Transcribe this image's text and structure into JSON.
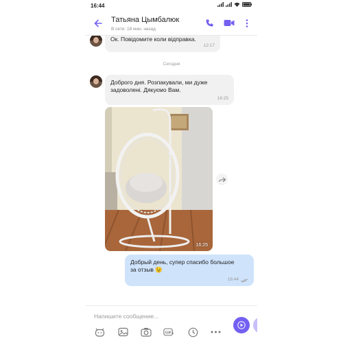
{
  "status_bar": {
    "time": "16:44"
  },
  "header": {
    "contact_name": "Татьяна Цымбалюк",
    "contact_status": "В сети: 18 мин. назад"
  },
  "messages": [
    {
      "direction": "in",
      "text": "Ок. Повідомите коли відправка.",
      "time": "12:17"
    },
    {
      "direction": "in",
      "text": "Доброго дня. Розпакували, ми дуже задоволені. Дякуємо Вам.",
      "time": "16:25"
    },
    {
      "direction": "in",
      "type": "photo",
      "time": "16:25"
    },
    {
      "direction": "out",
      "text": "Добрый день, супер спасибо большое за отзыв 😉",
      "time": "16:44"
    }
  ],
  "date_separator": "Сегодня",
  "composer": {
    "placeholder": "Напишите сообщение...",
    "toolbar_icons": [
      "sticker-icon",
      "gallery-icon",
      "camera-icon",
      "gif-icon",
      "clock-icon",
      "more-icon"
    ]
  },
  "colors": {
    "accent": "#7360f2",
    "incoming_bubble": "#f1f1f2",
    "outgoing_bubble": "#cfe3fb"
  }
}
